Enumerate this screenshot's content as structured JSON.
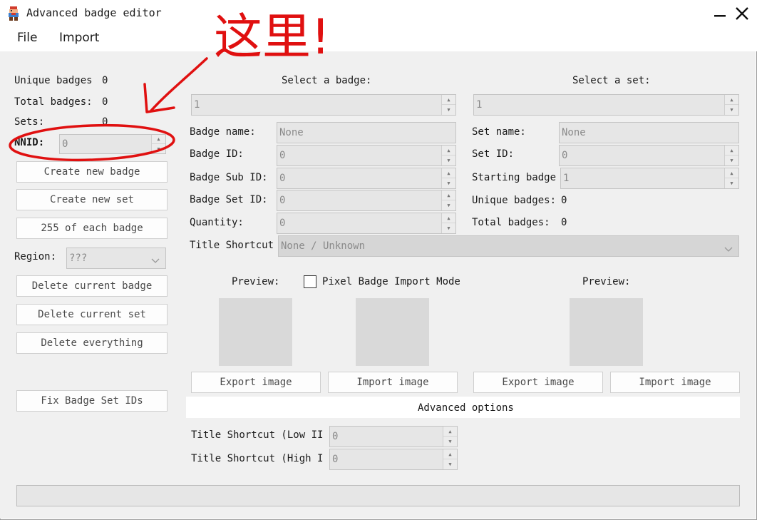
{
  "window": {
    "title": "Advanced badge editor"
  },
  "menu": {
    "file": "File",
    "import": "Import"
  },
  "annotation": {
    "text": "这里!",
    "color": "#e01010"
  },
  "left": {
    "unique_badges_label": "Unique badges",
    "unique_badges_value": "0",
    "total_badges_label": "Total badges:",
    "total_badges_value": "0",
    "sets_label": "Sets:",
    "sets_value": "0",
    "nnid_label": "NNID:",
    "nnid_value": "0",
    "create_badge": "Create new badge",
    "create_set": "Create new set",
    "each_badge": "255 of each badge",
    "region_label": "Region:",
    "region_value": "???",
    "delete_badge": "Delete current badge",
    "delete_set": "Delete current set",
    "delete_all": "Delete everything",
    "fix_ids": "Fix Badge Set IDs"
  },
  "badge": {
    "select_label": "Select a badge:",
    "select_value": "1",
    "name_label": "Badge name:",
    "name_value": "None",
    "id_label": "Badge ID:",
    "id_value": "0",
    "sub_id_label": "Badge Sub ID:",
    "sub_id_value": "0",
    "set_id_label": "Badge Set ID:",
    "set_id_value": "0",
    "quantity_label": "Quantity:",
    "quantity_value": "0",
    "title_shortcut_label": "Title Shortcut",
    "title_shortcut_value": "None / Unknown",
    "preview_label": "Preview:",
    "pixel_mode_label": "Pixel Badge Import Mode",
    "export_image": "Export image",
    "import_image": "Import image"
  },
  "set": {
    "select_label": "Select a set:",
    "select_value": "1",
    "name_label": "Set name:",
    "name_value": "None",
    "id_label": "Set ID:",
    "id_value": "0",
    "starting_label": "Starting badge",
    "starting_value": "1",
    "unique_label": "Unique badges:",
    "unique_value": "0",
    "total_label": "Total badges:",
    "total_value": "0",
    "preview_label": "Preview:",
    "export_image": "Export image",
    "import_image": "Import image"
  },
  "advanced": {
    "heading": "Advanced options",
    "low_label": "Title Shortcut (Low II",
    "low_value": "0",
    "high_label": "Title Shortcut (High I",
    "high_value": "0"
  }
}
